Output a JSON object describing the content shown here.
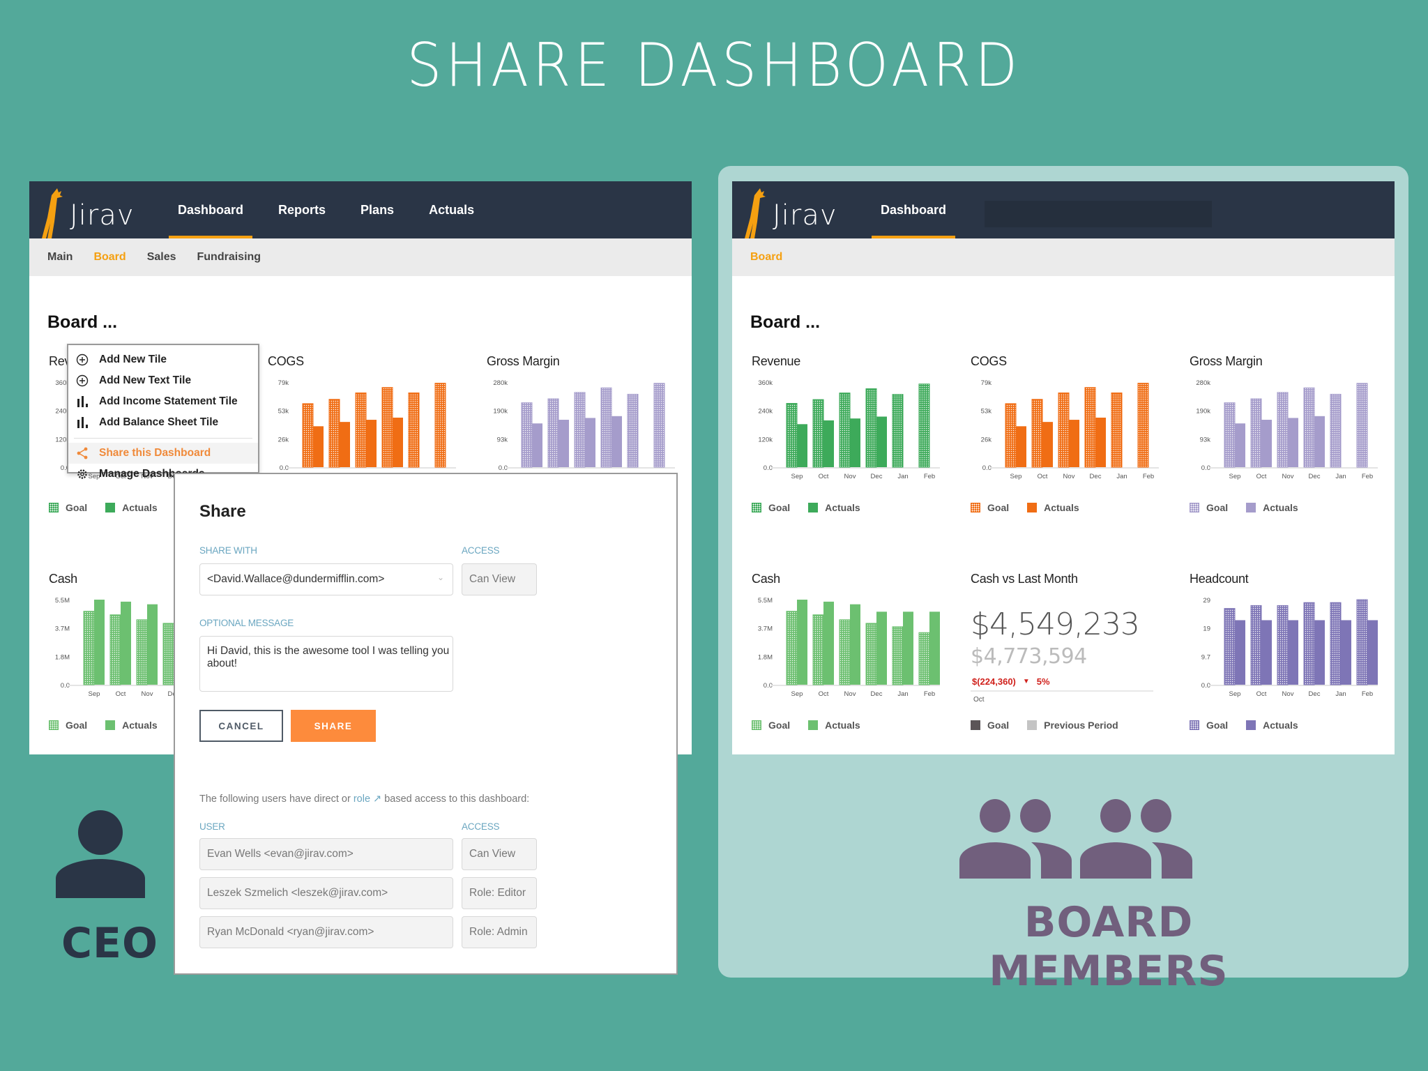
{
  "page": {
    "title": "SHARE DASHBOARD"
  },
  "colors": {
    "background": "#53a99a",
    "board_panel": "#aed6d2",
    "topbar": "#2a3546",
    "accent": "#f5a011",
    "share_orange": "#fd8b3c",
    "label_blue": "#6aa6c0",
    "green_goal": "#3daa5a",
    "green_light": "#6cc070",
    "orange": "#f06d14",
    "lavender": "#a59ccb",
    "purple": "#7e75b6",
    "negative": "#d0211c",
    "ceo_icon": "#2a3546",
    "board_icon": "#715f7d"
  },
  "ceo_app": {
    "logo": "Jirav",
    "nav": [
      "Dashboard",
      "Reports",
      "Plans",
      "Actuals"
    ],
    "nav_active": "Dashboard",
    "subnav": [
      "Main",
      "Board",
      "Sales",
      "Fundraising"
    ],
    "subnav_active": "Board",
    "board_title": "Board ...",
    "tiles": {
      "revenue_title_partial": "Rev",
      "cogs_title": "COGS",
      "gross_margin_title": "Gross Margin",
      "cash_title": "Cash"
    },
    "legend": {
      "goal": "Goal",
      "actuals": "Actuals"
    }
  },
  "board_menu": {
    "items": [
      {
        "label": "Add New Tile",
        "icon": "plus-circle-icon"
      },
      {
        "label": "Add New Text Tile",
        "icon": "plus-circle-icon"
      },
      {
        "label": "Add Income Statement Tile",
        "icon": "bar-chart-icon"
      },
      {
        "label": "Add Balance Sheet Tile",
        "icon": "bar-chart-icon"
      },
      {
        "label": "Share this Dashboard",
        "icon": "share-icon",
        "highlighted": true
      },
      {
        "label": "Manage Dashboards",
        "icon": "gear-icon"
      }
    ]
  },
  "share_modal": {
    "title": "Share",
    "share_with_label": "SHARE WITH",
    "share_with_value": "<David.Wallace@dundermifflin.com>",
    "access_label": "ACCESS",
    "access_value": "Can View",
    "message_label": "OPTIONAL MESSAGE",
    "message_value": "Hi David, this is the awesome tool I was telling you about!",
    "cancel_label": "CANCEL",
    "share_label": "SHARE",
    "note_prefix": "The following users have direct or ",
    "note_link": "role",
    "note_suffix": " based access to this dashboard:",
    "user_col": "USER",
    "access_col": "ACCESS",
    "users": [
      {
        "user": "Evan Wells <evan@jirav.com>",
        "access": "Can View"
      },
      {
        "user": "Leszek Szmelich <leszek@jirav.com>",
        "access": "Role: Editor"
      },
      {
        "user": "Ryan McDonald <ryan@jirav.com>",
        "access": "Role: Admin"
      }
    ]
  },
  "board_app": {
    "logo": "Jirav",
    "nav": [
      "Dashboard"
    ],
    "nav_active": "Dashboard",
    "subnav": [
      "Board"
    ],
    "subnav_active": "Board",
    "board_title": "Board ...",
    "kpi": {
      "title": "Cash vs Last Month",
      "current": "$4,549,233",
      "previous": "$4,773,594",
      "delta": "$(224,360)",
      "delta_pct": "5%",
      "direction": "down",
      "month": "Oct",
      "legend": {
        "goal": "Goal",
        "previous": "Previous Period"
      }
    }
  },
  "personas": {
    "ceo": "CEO",
    "board": "BOARD MEMBERS"
  },
  "chart_data": [
    {
      "id": "revenue",
      "type": "bar",
      "title": "Revenue",
      "categories": [
        "Sep",
        "Oct",
        "Nov",
        "Dec",
        "Jan",
        "Feb"
      ],
      "yticks": [
        "0.0",
        "120k",
        "240k",
        "360k"
      ],
      "ylim": [
        0,
        360000
      ],
      "series": [
        {
          "name": "Goal",
          "style": "hatched",
          "color": "#3daa5a",
          "values": [
            270000,
            286000,
            314000,
            332000,
            308000,
            352000
          ]
        },
        {
          "name": "Actuals",
          "style": "solid",
          "color": "#3daa5a",
          "values": [
            182000,
            198000,
            206000,
            214000,
            null,
            null
          ]
        }
      ]
    },
    {
      "id": "cogs",
      "type": "bar",
      "title": "COGS",
      "categories": [
        "Sep",
        "Oct",
        "Nov",
        "Dec",
        "Jan",
        "Feb"
      ],
      "yticks": [
        "0.0",
        "26k",
        "53k",
        "79k"
      ],
      "ylim": [
        0,
        79000
      ],
      "series": [
        {
          "name": "Goal",
          "style": "hatched",
          "color": "#f06d14",
          "values": [
            59000,
            63000,
            69000,
            74000,
            69000,
            78000
          ]
        },
        {
          "name": "Actuals",
          "style": "solid",
          "color": "#f06d14",
          "values": [
            38000,
            42000,
            44000,
            46000,
            null,
            null
          ]
        }
      ]
    },
    {
      "id": "gross_margin",
      "type": "bar",
      "title": "Gross Margin",
      "categories": [
        "Sep",
        "Oct",
        "Nov",
        "Dec",
        "Jan",
        "Feb"
      ],
      "yticks": [
        "0.0",
        "93k",
        "190k",
        "280k"
      ],
      "ylim": [
        0,
        280000
      ],
      "series": [
        {
          "name": "Goal",
          "style": "hatched",
          "color": "#a59ccb",
          "values": [
            212000,
            225000,
            246000,
            261000,
            240000,
            276000
          ]
        },
        {
          "name": "Actuals",
          "style": "solid",
          "color": "#a59ccb",
          "values": [
            144000,
            156000,
            162000,
            168000,
            null,
            null
          ]
        }
      ]
    },
    {
      "id": "cash",
      "type": "bar",
      "title": "Cash",
      "categories": [
        "Sep",
        "Oct",
        "Nov",
        "Dec",
        "Jan",
        "Feb"
      ],
      "yticks": [
        "0.0",
        "1.8M",
        "3.7M",
        "5.5M"
      ],
      "ylim": [
        0,
        5500000
      ],
      "series": [
        {
          "name": "Goal",
          "style": "hatched",
          "color": "#6cc070",
          "values": [
            4750000,
            4520000,
            4200000,
            3970000,
            3750000,
            3370000
          ]
        },
        {
          "name": "Actuals",
          "style": "solid",
          "color": "#6cc070",
          "values": [
            5500000,
            5370000,
            5200000,
            4720000,
            4720000,
            4720000
          ]
        }
      ]
    },
    {
      "id": "headcount",
      "type": "bar",
      "title": "Headcount",
      "categories": [
        "Sep",
        "Oct",
        "Nov",
        "Dec",
        "Jan",
        "Feb"
      ],
      "yticks": [
        "0.0",
        "9.7",
        "19",
        "29"
      ],
      "ylim": [
        0,
        29
      ],
      "series": [
        {
          "name": "Goal",
          "style": "hatched",
          "color": "#7e75b6",
          "values": [
            26,
            27,
            27,
            28,
            28,
            29
          ]
        },
        {
          "name": "Actuals",
          "style": "solid",
          "color": "#7e75b6",
          "values": [
            22,
            22,
            22,
            22,
            22,
            22
          ]
        }
      ]
    }
  ]
}
